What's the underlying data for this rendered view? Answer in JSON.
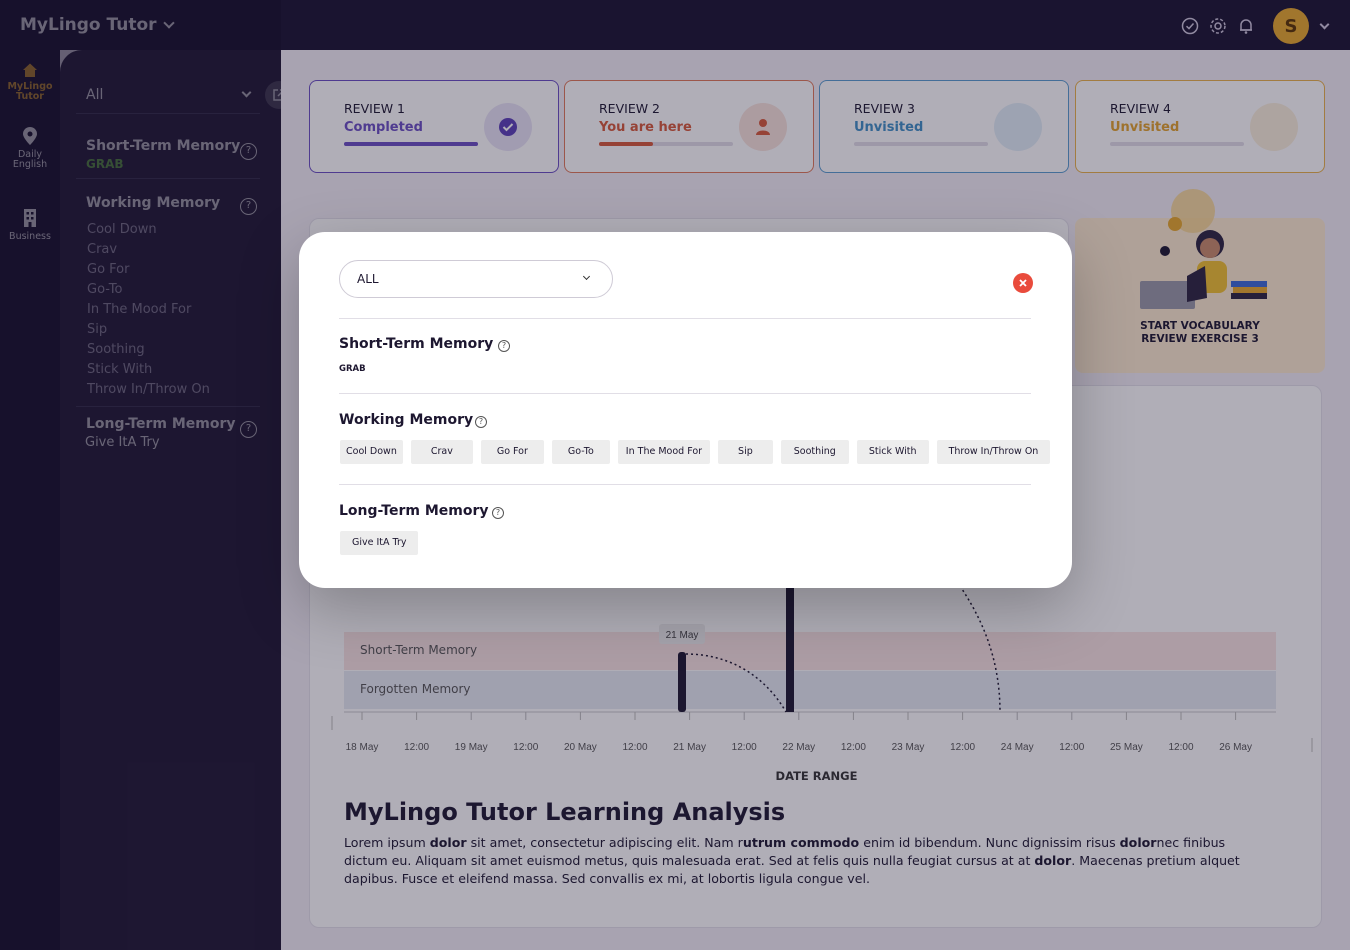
{
  "app": {
    "title": "MyLingo Tutor",
    "avatar_letter": "S"
  },
  "topbar": {
    "icons": [
      "check-circle-icon",
      "gear-icon",
      "bell-icon"
    ]
  },
  "rail": {
    "items": [
      {
        "label_line1": "MyLingo",
        "label_line2": "Tutor",
        "icon": "home-icon",
        "active": true
      },
      {
        "label_line1": "Daily",
        "label_line2": "English",
        "icon": "map-pin-icon",
        "active": false
      },
      {
        "label_line1": "Business",
        "label_line2": "",
        "icon": "building-icon",
        "active": false
      }
    ]
  },
  "sidebar": {
    "filter_value": "All",
    "short_term": {
      "title": "Short-Term Memory",
      "word": "GRAB"
    },
    "working": {
      "title": "Working Memory",
      "items": [
        "Cool Down",
        "Crav",
        "Go For",
        "Go-To",
        "In The Mood For",
        "Sip",
        "Soothing",
        "Stick With",
        "Throw In/Throw On"
      ]
    },
    "long_term": {
      "title": "Long-Term Memory",
      "word": "Give ItA Try"
    }
  },
  "reviews": [
    {
      "label": "REVIEW 1",
      "status": "Completed",
      "progress": 1.0,
      "color": "#6a4fc4",
      "icon": "check-icon"
    },
    {
      "label": "REVIEW 2",
      "status": "You are here",
      "progress": 0.4,
      "color": "#d85a3a",
      "icon": "person-icon"
    },
    {
      "label": "REVIEW 3",
      "status": "Unvisited",
      "progress": 0,
      "color": "#3f8fc6",
      "icon": ""
    },
    {
      "label": "REVIEW 4",
      "status": "Unvisited",
      "progress": 0,
      "color": "#e3a32c",
      "icon": ""
    }
  ],
  "promo": {
    "line1": "START VOCABULARY",
    "line2": "REVIEW EXERCISE 3"
  },
  "chart": {
    "bands": [
      "Short-Term Memory",
      "Forgotten Memory"
    ],
    "tooltip": "21 May",
    "x_ticks": [
      "18 May",
      "12:00",
      "19 May",
      "12:00",
      "20 May",
      "12:00",
      "21 May",
      "12:00",
      "22 May",
      "12:00",
      "23 May",
      "12:00",
      "24 May",
      "12:00",
      "25 May",
      "12:00",
      "26 May"
    ],
    "x_title": "DATE RANGE"
  },
  "analysis": {
    "title": "MyLingo Tutor Learning Analysis",
    "p1": "Lorem ipsum ",
    "b1": "dolor",
    "p2": " sit amet, consectetur adipiscing elit. Nam r",
    "b2": "utrum commodo",
    "p3": " enim id bibendum. Nunc dignissim risus ",
    "b3": "dolor",
    "p4": "nec finibus dictum eu. Aliquam sit amet euismod metus, quis malesuada erat. Sed at felis quis nulla feugiat cursus at at ",
    "b4": "dolor",
    "p5": ". Maecenas pretium alquet dapibus. Fusce et eleifend massa.  Sed convallis ex mi, at lobortis ligula congue vel."
  },
  "modal": {
    "select_value": "ALL",
    "short_term": {
      "title": "Short-Term Memory",
      "word": "GRAB"
    },
    "working": {
      "title": "Working Memory",
      "chips": [
        "Cool Down",
        "Crav",
        "Go For",
        "Go-To",
        "In The Mood For",
        "Sip",
        "Soothing",
        "Stick With",
        "Throw In/Throw On"
      ]
    },
    "long_term": {
      "title": "Long-Term Memory",
      "chips": [
        "Give ItA Try"
      ]
    }
  }
}
